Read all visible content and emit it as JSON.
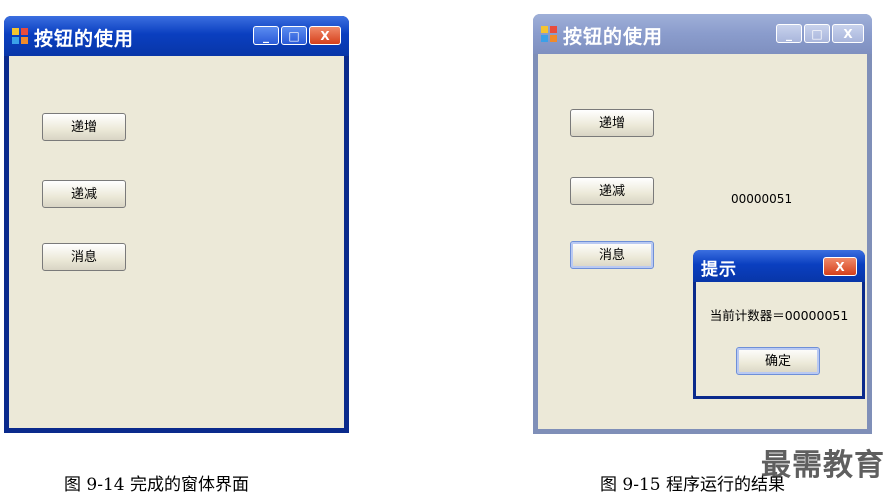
{
  "figure1": {
    "window_title": "按钮的使用",
    "buttons": [
      "递增",
      "递减",
      "消息"
    ],
    "caption": "图 9-14 完成的窗体界面"
  },
  "figure2": {
    "window_title": "按钮的使用",
    "buttons": [
      "递增",
      "递减",
      "消息"
    ],
    "counter_label": "00000051",
    "dialog": {
      "title": "提示",
      "message": "当前计数器＝00000051",
      "ok_label": "确定"
    },
    "caption": "图 9-15 程序运行的结果"
  },
  "window_controls": {
    "minimize": "_",
    "maximize": "□",
    "close": "X"
  },
  "watermark": "最需教育"
}
